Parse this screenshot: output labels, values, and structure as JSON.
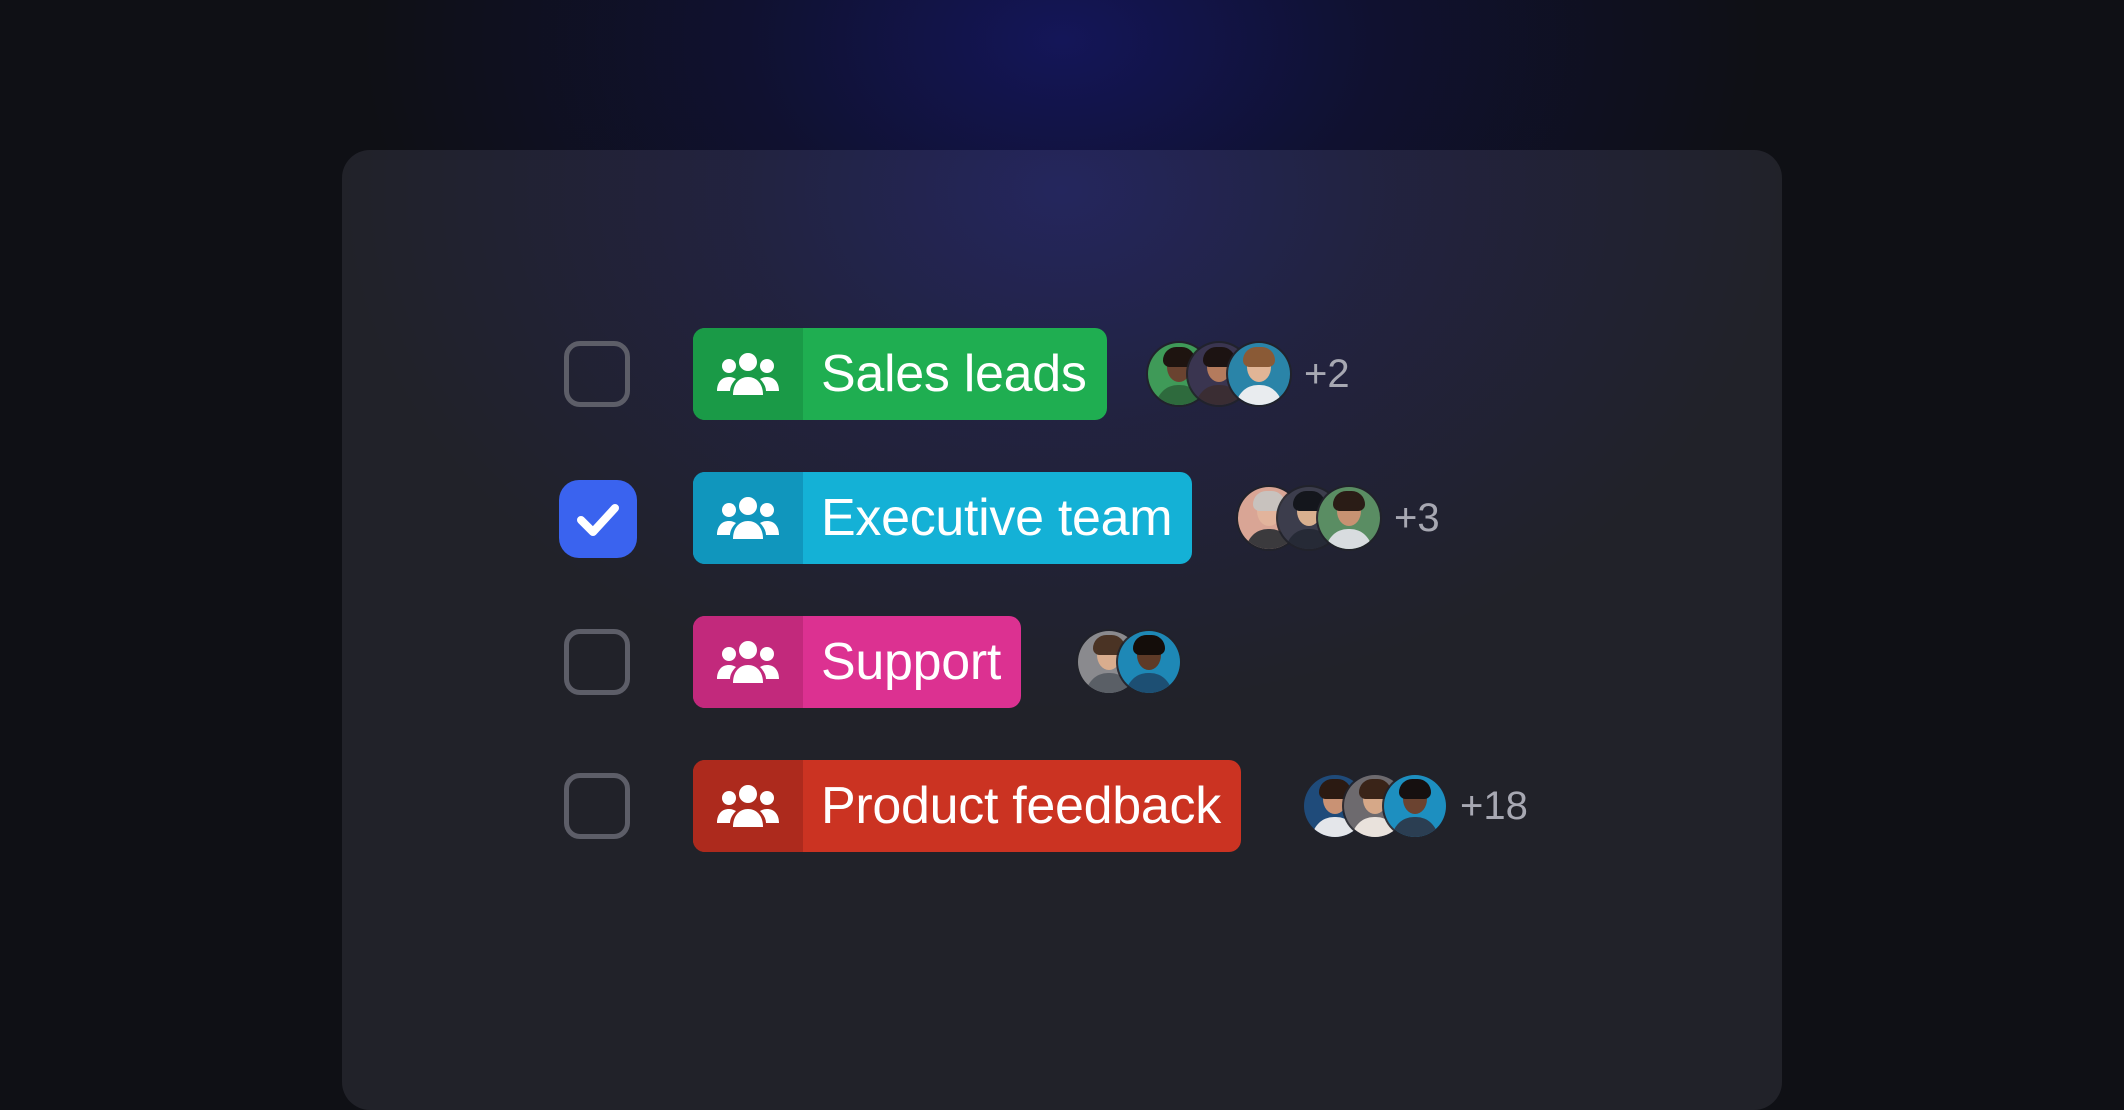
{
  "groups": [
    {
      "label": "Sales leads",
      "checked": false,
      "color": "#1fae51",
      "icon_bg": "#1a9a47",
      "icon": "group-icon",
      "avatars": [
        {
          "bg": "#3f9a58",
          "skin": "#6a4330",
          "hair": "#1e1410",
          "shirt": "#2e6a3d"
        },
        {
          "bg": "#3a3550",
          "skin": "#b47b5d",
          "hair": "#1c1312",
          "shirt": "#3a2d33"
        },
        {
          "bg": "#2a84a8",
          "skin": "#e1b596",
          "hair": "#8a5a36",
          "shirt": "#e9ecef"
        }
      ],
      "extra_count": "+2"
    },
    {
      "label": "Executive team",
      "checked": true,
      "color": "#14b1d6",
      "icon_bg": "#1096bd",
      "icon": "group-icon",
      "avatars": [
        {
          "bg": "#d9a595",
          "skin": "#e2b49c",
          "hair": "#c8c2be",
          "shirt": "#3b3a3d"
        },
        {
          "bg": "#3c3d4c",
          "skin": "#d9b08f",
          "hair": "#14161c",
          "shirt": "#262a36"
        },
        {
          "bg": "#5a8d63",
          "skin": "#c89272",
          "hair": "#2a1c16",
          "shirt": "#d8dcdf"
        }
      ],
      "extra_count": "+3"
    },
    {
      "label": "Support",
      "checked": false,
      "color": "#dc3191",
      "icon_bg": "#c2297c",
      "icon": "group-icon",
      "avatars": [
        {
          "bg": "#8a8a8e",
          "skin": "#d9ad8e",
          "hair": "#4a3324",
          "shirt": "#5a5f66"
        },
        {
          "bg": "#1e88b6",
          "skin": "#5e3a27",
          "hair": "#140d0a",
          "shirt": "#1d4f73"
        }
      ],
      "extra_count": ""
    },
    {
      "label": "Product feedback",
      "checked": false,
      "color": "#cb3322",
      "icon_bg": "#ad2a1d",
      "icon": "group-icon",
      "avatars": [
        {
          "bg": "#1f4b7a",
          "skin": "#c99274",
          "hair": "#2b1a12",
          "shirt": "#e4e6ea"
        },
        {
          "bg": "#6d6a6e",
          "skin": "#d6a888",
          "hair": "#3a2418",
          "shirt": "#e9e2dc"
        },
        {
          "bg": "#1d8fc0",
          "skin": "#6b4330",
          "hair": "#161010",
          "shirt": "#2b3e52"
        }
      ],
      "extra_count": "+18"
    }
  ]
}
